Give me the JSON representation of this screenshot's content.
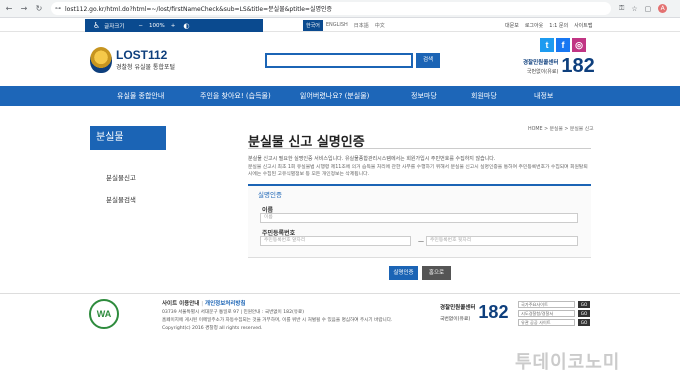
{
  "browser": {
    "url": "lost112.go.kr/html.do?html=~/lost/firstNameCheck&sub=LS&title=분실물&ptitle=실명인증",
    "icons": [
      "back-icon",
      "forward-icon",
      "reload-icon",
      "site-info-icon"
    ],
    "avatar_initial": "A"
  },
  "accessibility": {
    "label": "글자크기",
    "minus": "−",
    "zoom": "100%",
    "plus": "+"
  },
  "languages": [
    "한국어",
    "ENGLISH",
    "日本語",
    "中文"
  ],
  "top_links": [
    "대문보",
    "로그아웃",
    "1:1 문의",
    "사이트맵"
  ],
  "logo": {
    "title": "LOST112",
    "subtitle": "경찰청 유실물 통합포털"
  },
  "search": {
    "placeholder": "",
    "button": "검색"
  },
  "call_center": {
    "name": "경찰민원콜센터",
    "sub": "국번없이(유료)",
    "number": "182"
  },
  "gnb": [
    "유실물 종합안내",
    "주인을 찾아요! (습득물)",
    "잃어버렸나요? (분실물)",
    "정보마당",
    "회원마당",
    "내정보"
  ],
  "sidebar": {
    "title": "분실물",
    "items": [
      "분실물신고",
      "분실물검색"
    ]
  },
  "main": {
    "title": "분실물 신고 실명인증",
    "breadcrumb": "HOME > 분실물 > 분실물 신고",
    "desc1": "분실물 신고시 필요한 실명인증 서비스입니다. 유실물종합관리시스템에서는 회원가입시 주민번호를 수집하지 않습니다.",
    "desc2": "분실물 신고시 최초 1회 유실물법 시행령 제11조에 의거 습득물 처리에 관한 사무를 수행하기 위해서 분실물 신고시 실명인증을 통하여 주민등록번호가 수집되며 회원탈퇴시에는 수집된 고유식별정보 등 모든 개인정보는 삭제됩니다."
  },
  "form": {
    "legend": "실명인증",
    "name_label": "이름",
    "name_placeholder": "이름",
    "rrn_label": "주민등록번호",
    "rrn_front_placeholder": "주민등록번호 앞자리",
    "rrn_back_placeholder": "주민등록번호 뒷자리",
    "dash": "—",
    "verify_button": "실명인증",
    "home_button": "홈으로"
  },
  "footer": {
    "badge": "WA",
    "terms": "사이트 이용안내",
    "separator": "|",
    "privacy": "개인정보처리방침",
    "address": "03739 서울특별시 서대문구 통일로 97 | 민원안내 : 국번없이 182(유료)",
    "notice": "홈페이지에 게시된 이메일주소가 자동수집되는 것을 거부하며, 이를 위반 시 처벌될 수 있음을 명심하여 주시기 바랍니다.",
    "copyright": "Copyright(c) 2016 경찰청 all rights reserved.",
    "center_name": "경찰민원콜센터",
    "center_sub": "국번없이(유료)",
    "center_number": "182",
    "selects": [
      "국가주요사이트",
      "시도경찰청/경찰서",
      "유관 공공 사이트"
    ],
    "go": "GO"
  },
  "watermark": "투데이코노미"
}
